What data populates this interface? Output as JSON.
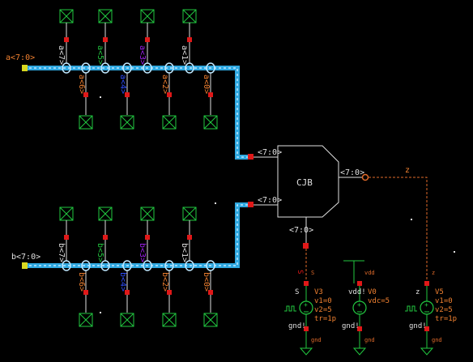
{
  "colors": {
    "background": "#000000",
    "wire": "#2fa8e0",
    "wire_selected": "#bfe8ff",
    "net": "#e06a2a",
    "component": "#22c840",
    "pin": "#e01818",
    "symbol_outline": "#e0e0e0",
    "label": "#f08030",
    "ground": "#22c840"
  },
  "bus_a": {
    "label": "a<7:0>",
    "bit_labels": [
      "a<7>",
      "a<6>",
      "a<5>",
      "a<4>",
      "a<3>",
      "a<2>",
      "a<1>",
      "a<0>"
    ]
  },
  "bus_b": {
    "label": "b<7:0>",
    "bit_labels": [
      "b<7>",
      "b<6>",
      "b<5>",
      "b<4>",
      "b<3>",
      "b<2>",
      "b<1>",
      "b<0>"
    ]
  },
  "block": {
    "name": "CJB",
    "pins": {
      "in_a": "<7:0>",
      "in_b": "<7:0>",
      "out_z": "<7:0>",
      "bottom": "<7:0>"
    }
  },
  "nets": {
    "z": "z",
    "s": "S"
  },
  "sources": [
    {
      "id": "V3",
      "top": "S",
      "net": "S",
      "params": [
        "v1=0",
        "v2=5",
        "tr=1p"
      ],
      "gnd": "gnd!",
      "gnd_net": "gnd"
    },
    {
      "id": "V0",
      "top": "vdd!",
      "net": "vdd",
      "params": [
        "vdc=5"
      ],
      "gnd": "gnd!",
      "gnd_net": "gnd"
    },
    {
      "id": "V5",
      "top": "z",
      "net": "z",
      "params": [
        "v1=0",
        "v2=5",
        "tr=1p"
      ],
      "gnd": "gnd!",
      "gnd_net": "gnd"
    }
  ]
}
